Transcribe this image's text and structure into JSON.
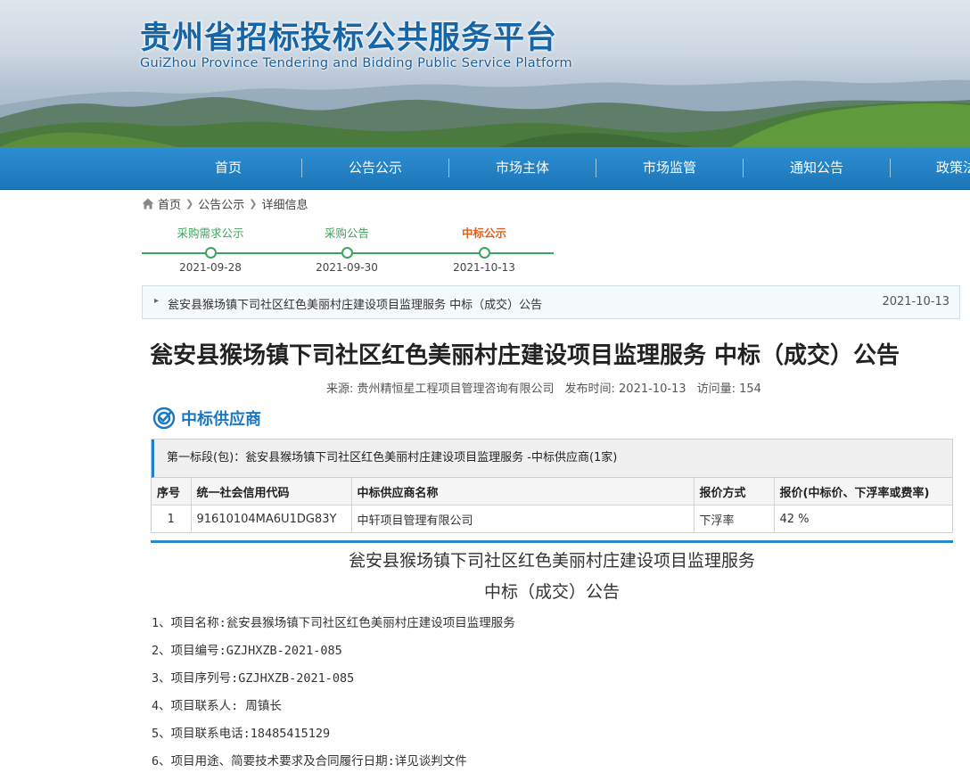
{
  "site": {
    "title": "贵州省招标投标公共服务平台",
    "subtitle": "GuiZhou Province Tendering and Bidding Public Service Platform"
  },
  "nav": {
    "items": [
      {
        "label": "首页"
      },
      {
        "label": "公告公示"
      },
      {
        "label": "市场主体"
      },
      {
        "label": "市场监管"
      },
      {
        "label": "通知公告"
      },
      {
        "label": "政策法"
      }
    ]
  },
  "breadcrumb": {
    "home_icon": "home-icon",
    "items": [
      "首页",
      "公告公示",
      "详细信息"
    ],
    "separator_icon": "chevron-right-icon"
  },
  "timeline": {
    "steps": [
      {
        "label": "采购需求公示",
        "date": "2021-09-28",
        "active": false
      },
      {
        "label": "采购公告",
        "date": "2021-09-30",
        "active": false
      },
      {
        "label": "中标公示",
        "date": "2021-10-13",
        "active": true
      }
    ],
    "colors": {
      "done": "#3aa55c",
      "active": "#e0611c"
    }
  },
  "notice": {
    "title": "瓮安县猴场镇下司社区红色美丽村庄建设项目监理服务 中标（成交）公告",
    "date": "2021-10-13"
  },
  "article": {
    "title": "瓮安县猴场镇下司社区红色美丽村庄建设项目监理服务 中标（成交）公告",
    "source": "来源: 贵州精恒星工程项目管理咨询有限公司",
    "publish_time": "发布时间: 2021-10-13",
    "views": "访问量: 154"
  },
  "winner_section": {
    "icon": "target-icon",
    "title": "中标供应商",
    "package_title": "第一标段(包)：瓮安县猴场镇下司社区红色美丽村庄建设项目监理服务 -中标供应商(1家)",
    "headers": [
      "序号",
      "统一社会信用代码",
      "中标供应商名称",
      "报价方式",
      "报价(中标价、下浮率或费率)"
    ],
    "rows": [
      [
        "1",
        "91610104MA6U1DG83Y",
        "中轩项目管理有限公司",
        "下浮率",
        "42 %"
      ]
    ]
  },
  "content": {
    "heading_line1": "瓮安县猴场镇下司社区红色美丽村庄建设项目监理服务",
    "heading_line2": "中标（成交）公告",
    "items": [
      "1、项目名称:瓮安县猴场镇下司社区红色美丽村庄建设项目监理服务",
      "2、项目编号:GZJHXZB-2021-085",
      "3、项目序列号:GZJHXZB-2021-085",
      "4、项目联系人: 周镇长",
      "5、项目联系电话:18485415129",
      "6、项目用途、简要技术要求及合同履行日期:详见谈判文件"
    ]
  },
  "colors": {
    "brand_blue": "#1a78c2",
    "nav_blue": "#1c76b9",
    "accent_orange": "#e0611c",
    "green": "#3aa55c"
  }
}
